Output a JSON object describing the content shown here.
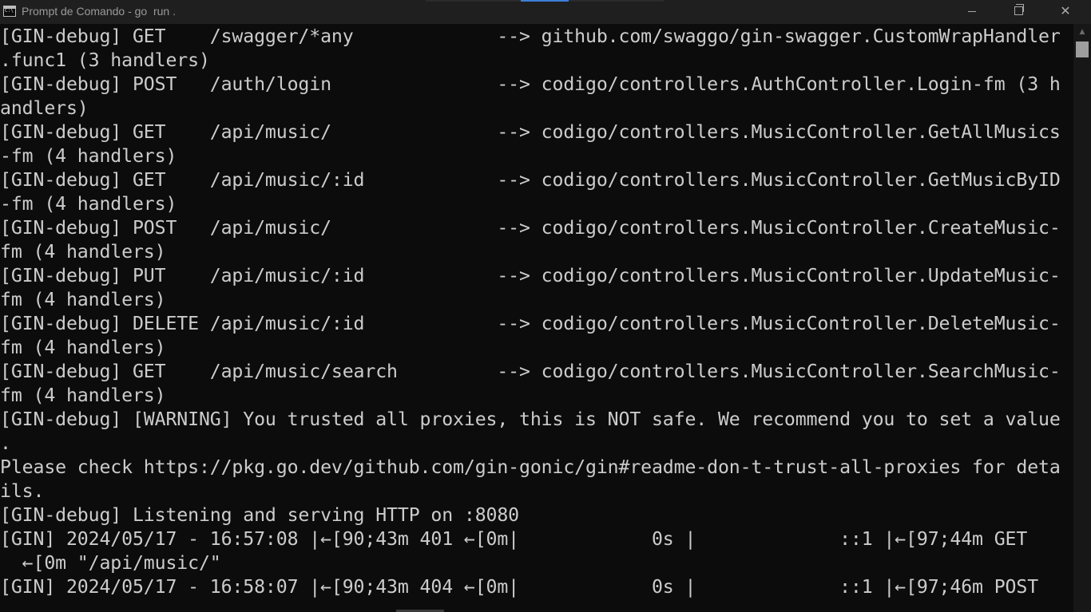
{
  "window": {
    "title": "Prompt de Comando - go  run .",
    "app_icon": "cmd-icon",
    "controls": {
      "minimize_icon": "minimize-icon",
      "maximize_icon": "restore-icon",
      "close_icon": "close-icon",
      "close_glyph": "✕"
    }
  },
  "colors": {
    "background": "#0c0c0c",
    "foreground": "#cccccc",
    "titlebar": "#1f1f1f",
    "scroll_thumb": "#9d9d9d"
  },
  "console": {
    "lines": [
      "[GIN-debug] GET    /swagger/*any             --> github.com/swaggo/gin-swagger.CustomWrapHandler",
      ".func1 (3 handlers)",
      "[GIN-debug] POST   /auth/login               --> codigo/controllers.AuthController.Login-fm (3 h",
      "andlers)",
      "[GIN-debug] GET    /api/music/               --> codigo/controllers.MusicController.GetAllMusics",
      "-fm (4 handlers)",
      "[GIN-debug] GET    /api/music/:id            --> codigo/controllers.MusicController.GetMusicByID",
      "-fm (4 handlers)",
      "[GIN-debug] POST   /api/music/               --> codigo/controllers.MusicController.CreateMusic-",
      "fm (4 handlers)",
      "[GIN-debug] PUT    /api/music/:id            --> codigo/controllers.MusicController.UpdateMusic-",
      "fm (4 handlers)",
      "[GIN-debug] DELETE /api/music/:id            --> codigo/controllers.MusicController.DeleteMusic-",
      "fm (4 handlers)",
      "[GIN-debug] GET    /api/music/search         --> codigo/controllers.MusicController.SearchMusic-",
      "fm (4 handlers)",
      "[GIN-debug] [WARNING] You trusted all proxies, this is NOT safe. We recommend you to set a value",
      ".",
      "Please check https://pkg.go.dev/github.com/gin-gonic/gin#readme-don-t-trust-all-proxies for deta",
      "ils.",
      "[GIN-debug] Listening and serving HTTP on :8080",
      "[GIN] 2024/05/17 - 16:57:08 |←[90;43m 401 ←[0m|            0s |             ::1 |←[97;44m GET",
      "  ←[0m \"/api/music/\"",
      "[GIN] 2024/05/17 - 16:58:07 |←[90;43m 404 ←[0m|            0s |             ::1 |←[97;46m POST"
    ]
  }
}
